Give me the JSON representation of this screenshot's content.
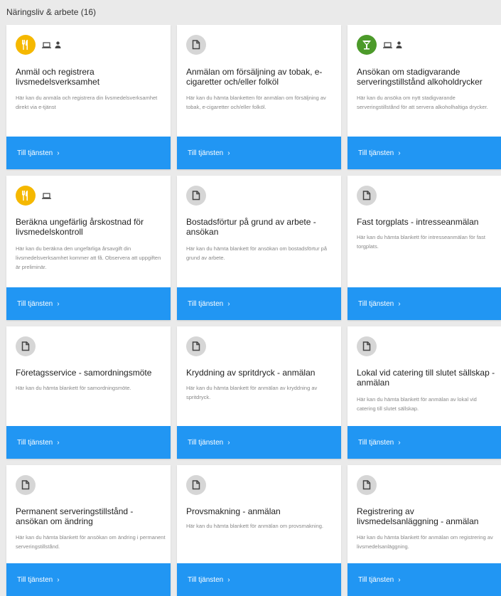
{
  "section": {
    "title": "Näringsliv & arbete (16)"
  },
  "colors": {
    "cta": "#2196f3",
    "yellow": "#f5b800",
    "green": "#4c9a2a",
    "gray": "#d6d6d6"
  },
  "cards": [
    {
      "icon": "fork-knife-icon",
      "extra_icons": [
        "laptop-icon",
        "person-icon"
      ],
      "title": "Anmäl och registrera livsmedelsverksamhet",
      "desc": "Här kan du anmäla och registrera din livsmedelsverksamhet direkt via e-tjänst",
      "cta": "Till tjänsten"
    },
    {
      "icon": "document-icon",
      "extra_icons": [],
      "title": "Anmälan om försäljning av tobak, e-cigaretter och/eller folköl",
      "desc": "Här kan du hämta blanketten för anmälan om försäljning av tobak, e-cigaretter och/eller folköl.",
      "cta": "Till tjänsten"
    },
    {
      "icon": "cocktail-icon",
      "extra_icons": [
        "laptop-icon",
        "person-icon"
      ],
      "title": "Ansökan om stadigvarande serveringstillstånd alkoholdrycker",
      "desc": "Här kan du ansöka om nytt stadigvarande serveringstillstånd för att servera alkoholhaltiga drycker.",
      "cta": "Till tjänsten"
    },
    {
      "icon": "fork-knife-icon",
      "extra_icons": [
        "laptop-icon"
      ],
      "title": "Beräkna ungefärlig årskostnad för livsmedelskontroll",
      "desc": "Här kan du beräkna den ungefärliga årsavgift din livsmedelsverksamhet kommer att få. Observera att uppgiften är preliminär.",
      "cta": "Till tjänsten"
    },
    {
      "icon": "document-icon",
      "extra_icons": [],
      "title": "Bostadsförtur på grund av arbete - ansökan",
      "desc": "Här kan du hämta blankett för ansökan om bostadsförtur på grund av arbete.",
      "cta": "Till tjänsten"
    },
    {
      "icon": "document-icon",
      "extra_icons": [],
      "title": "Fast torgplats - intresseanmälan",
      "desc": "Här kan du hämta blankett för intresseanmälan för fast torgplats.",
      "cta": "Till tjänsten"
    },
    {
      "icon": "document-icon",
      "extra_icons": [],
      "title": "Företagsservice - samordningsmöte",
      "desc": "Här kan du hämta blankett för samordningsmöte.",
      "cta": "Till tjänsten"
    },
    {
      "icon": "document-icon",
      "extra_icons": [],
      "title": "Kryddning av spritdryck - anmälan",
      "desc": "Här kan du hämta blankett för anmälan av kryddning av spritdryck.",
      "cta": "Till tjänsten"
    },
    {
      "icon": "document-icon",
      "extra_icons": [],
      "title": "Lokal vid catering till slutet sällskap - anmälan",
      "desc": "Här kan du hämta blankett för anmälan av lokal vid catering till slutet sällskap.",
      "cta": "Till tjänsten"
    },
    {
      "icon": "document-icon",
      "extra_icons": [],
      "title": "Permanent serveringstillstånd - ansökan om ändring",
      "desc": "Här kan du hämta blankett för ansökan om ändring i permanent serveringstillstånd.",
      "cta": "Till tjänsten"
    },
    {
      "icon": "document-icon",
      "extra_icons": [],
      "title": "Provsmakning - anmälan",
      "desc": "Här kan du hämta blankett för anmälan om provsmakning.",
      "cta": "Till tjänsten"
    },
    {
      "icon": "document-icon",
      "extra_icons": [],
      "title": "Registrering av livsmedelsanläggning - anmälan",
      "desc": "Här kan du hämta blankett för anmälan om registrering av livsmedelsanläggning.",
      "cta": "Till tjänsten"
    }
  ]
}
